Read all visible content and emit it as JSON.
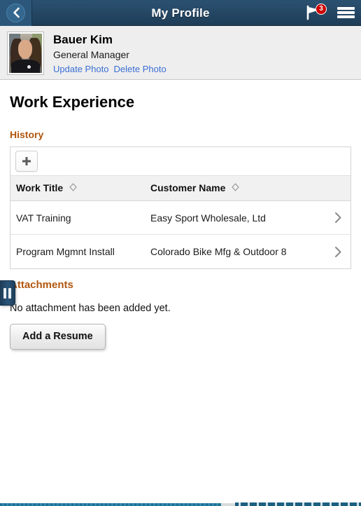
{
  "header": {
    "title": "My Profile",
    "back_icon": "chevron-left-icon",
    "flag_icon": "flag-icon",
    "notification_count": "3",
    "menu_icon": "hamburger-menu-icon",
    "bar_color": "#244a68",
    "badge_color": "#cc0000"
  },
  "profile": {
    "name": "Bauer Kim",
    "job_title": "General Manager",
    "avatar_icon": "profile-photo",
    "links": [
      {
        "label": "Update Photo"
      },
      {
        "label": "Delete Photo"
      }
    ],
    "link_color": "#3b6fd4"
  },
  "main": {
    "page_title": "Work Experience",
    "history_label": "History",
    "section_color": "#b2560d",
    "add_button_icon": "plus-icon",
    "table": {
      "columns": [
        {
          "label": "Work Title",
          "sort_icon": "sort-diamond-icon"
        },
        {
          "label": "Customer Name",
          "sort_icon": "sort-diamond-icon"
        }
      ],
      "rows": [
        {
          "work_title": "VAT Training",
          "customer_name": "Easy Sport Wholesale, Ltd",
          "arrow_icon": "chevron-right-icon"
        },
        {
          "work_title": "Program Mgmnt Install",
          "customer_name": "Colorado Bike Mfg & Outdoor  8",
          "arrow_icon": "chevron-right-icon"
        }
      ]
    }
  },
  "attachments": {
    "label": "Attachments",
    "empty_message": "No attachment has been added yet.",
    "add_button_label": "Add a Resume"
  },
  "drawer": {
    "handle_icon": "pause-bars-handle-icon"
  }
}
